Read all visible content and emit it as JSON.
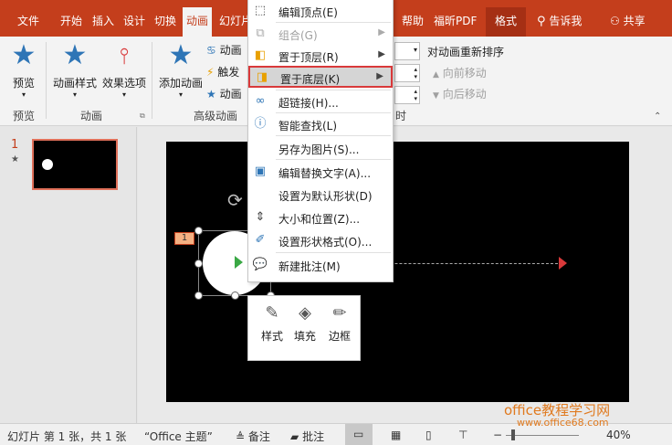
{
  "tabs": [
    "文件",
    "开始",
    "插入",
    "设计",
    "切换",
    "动画",
    "幻灯片",
    "帮助",
    "福昕PDF",
    "格式"
  ],
  "tell_me": "告诉我",
  "share": "共享",
  "ribbon": {
    "preview": "预览",
    "anim_style": "动画样式",
    "effect_options": "效果选项",
    "add_anim": "添加动画",
    "anim_pane": "动画",
    "trigger": "触发",
    "anim_painter": "动画",
    "reorder_title": "对动画重新排序",
    "move_earlier": "向前移动",
    "move_later": "向后移动",
    "group_preview": "预览",
    "group_anim": "动画",
    "group_advanced": "高级动画",
    "group_timing": "时"
  },
  "menu": {
    "items": [
      {
        "label": "编辑顶点(E)",
        "icon": "edit-points-icon",
        "enabled": true,
        "submenu": false
      },
      {
        "label": "组合(G)",
        "icon": "group-icon",
        "enabled": false,
        "submenu": true
      },
      {
        "label": "置于顶层(R)",
        "icon": "bring-front-icon",
        "enabled": true,
        "submenu": true
      },
      {
        "label": "置于底层(K)",
        "icon": "send-back-icon",
        "enabled": true,
        "submenu": true,
        "highlighted": true
      },
      {
        "label": "超链接(H)...",
        "icon": "hyperlink-icon",
        "enabled": true,
        "submenu": false
      },
      {
        "label": "智能查找(L)",
        "icon": "smart-lookup-icon",
        "enabled": true,
        "submenu": false
      },
      {
        "label": "另存为图片(S)...",
        "icon": "",
        "enabled": true,
        "submenu": false
      },
      {
        "label": "编辑替换文字(A)...",
        "icon": "alt-text-icon",
        "enabled": true,
        "submenu": false
      },
      {
        "label": "设置为默认形状(D)",
        "icon": "",
        "enabled": true,
        "submenu": false
      },
      {
        "label": "大小和位置(Z)...",
        "icon": "size-position-icon",
        "enabled": true,
        "submenu": false
      },
      {
        "label": "设置形状格式(O)...",
        "icon": "format-shape-icon",
        "enabled": true,
        "submenu": false
      },
      {
        "label": "新建批注(M)",
        "icon": "new-comment-icon",
        "enabled": true,
        "submenu": false
      }
    ]
  },
  "minitoolbar": {
    "style": "样式",
    "fill": "填充",
    "outline": "边框"
  },
  "slide": {
    "number": "1",
    "anim_badge": "1"
  },
  "watermark": {
    "line1": "office教程学习网",
    "line2": "www.office68.com"
  },
  "status": {
    "slide_info": "幻灯片 第 1 张，共 1 张",
    "theme": "“Office 主题”",
    "notes": "备注",
    "comments": "批注",
    "zoom": "40%"
  },
  "colors": {
    "accent": "#c43e1c",
    "highlight_border": "#d9393a"
  }
}
